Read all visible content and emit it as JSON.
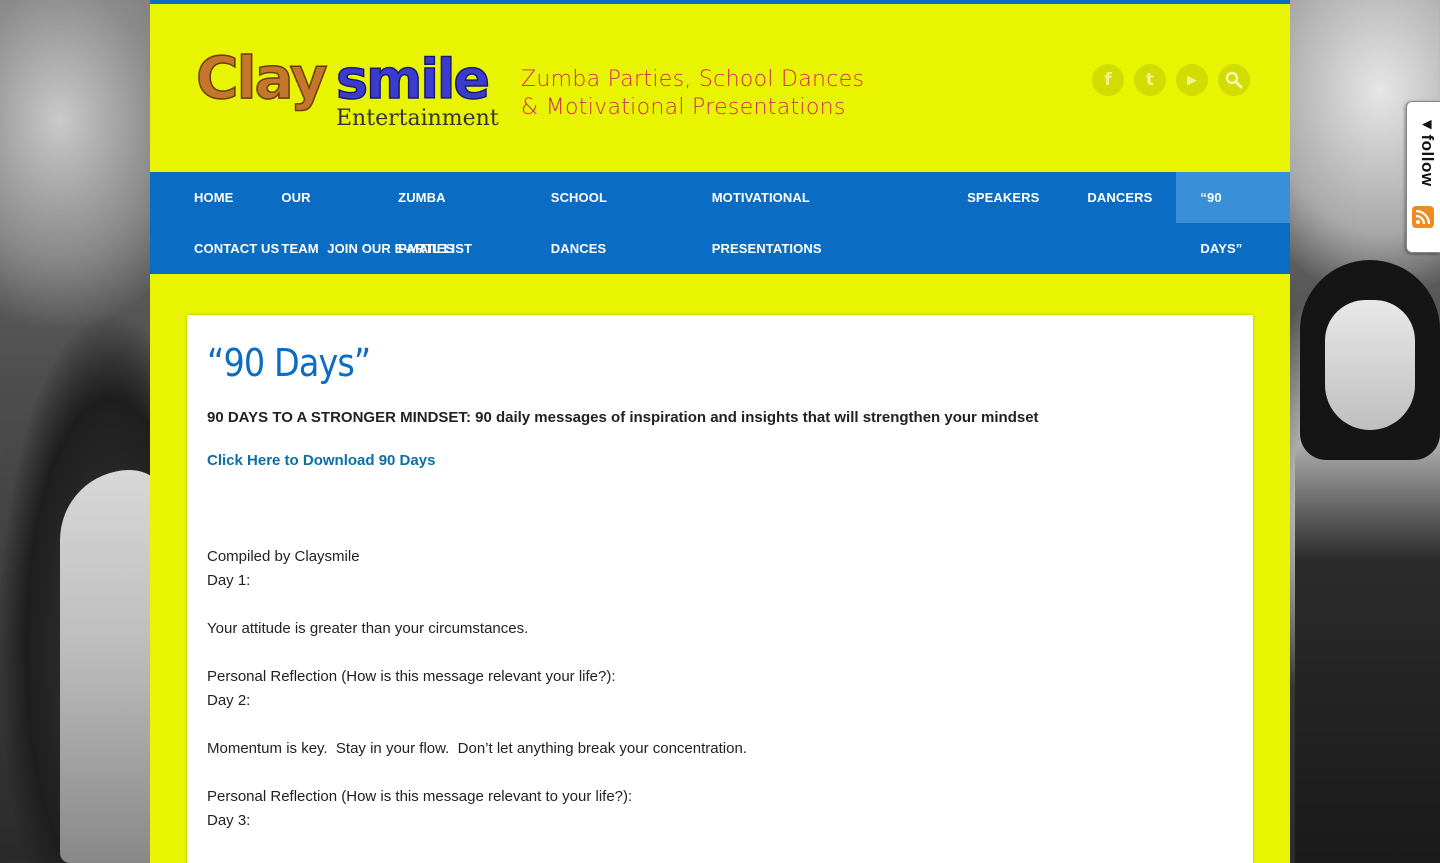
{
  "logo": {
    "brand_part1": "Clay",
    "brand_part2": "smile",
    "brand_sub": "Entertainment",
    "tagline_line1": "Zumba Parties, School Dances",
    "tagline_line2": "& Motivational Presentations"
  },
  "social": [
    {
      "icon": "facebook-icon",
      "glyph": "f"
    },
    {
      "icon": "twitter-icon",
      "glyph": "t"
    },
    {
      "icon": "youtube-icon",
      "glyph": "▶"
    },
    {
      "icon": "search-icon",
      "glyph": "⚲"
    }
  ],
  "nav": {
    "items": [
      {
        "label": "HOME"
      },
      {
        "label": "OUR TEAM"
      },
      {
        "label": "ZUMBA PARTIES"
      },
      {
        "label": "SCHOOL DANCES"
      },
      {
        "label": "MOTIVATIONAL PRESENTATIONS"
      },
      {
        "label": "SPEAKERS"
      },
      {
        "label": "DANCERS"
      },
      {
        "label": "“90 DAYS”"
      },
      {
        "label": "CONTACT US"
      },
      {
        "label": "JOIN OUR E-MAIL LIST"
      }
    ],
    "active": "“90 DAYS”"
  },
  "main": {
    "title": "“90 Days”",
    "intro": "90 DAYS TO A STRONGER MINDSET: 90 daily messages of inspiration and insights that will strengthen your mindset",
    "download_link": "Click Here to Download 90 Days",
    "compiled_by": "Compiled by Claysmile",
    "day1_label": "Day 1:",
    "day1_message": "Your attitude is greater than your circumstances.",
    "day1_reflection": "Personal Reflection (How is this message relevant your life?):",
    "day2_label": "Day 2:",
    "day2_message": "Momentum is key.  Stay in your flow.  Don’t let anything break your concentration.",
    "day2_reflection": "Personal Reflection (How is this message relevant to your life?):",
    "day3_label": "Day 3:"
  },
  "follow_widget": {
    "label": "◂follow",
    "rss_icon": "rss-icon"
  },
  "colors": {
    "accent": "#0b6cc3",
    "page_bg": "#e9f500",
    "tagline": "#d12b55",
    "link": "#0b6fa8"
  }
}
